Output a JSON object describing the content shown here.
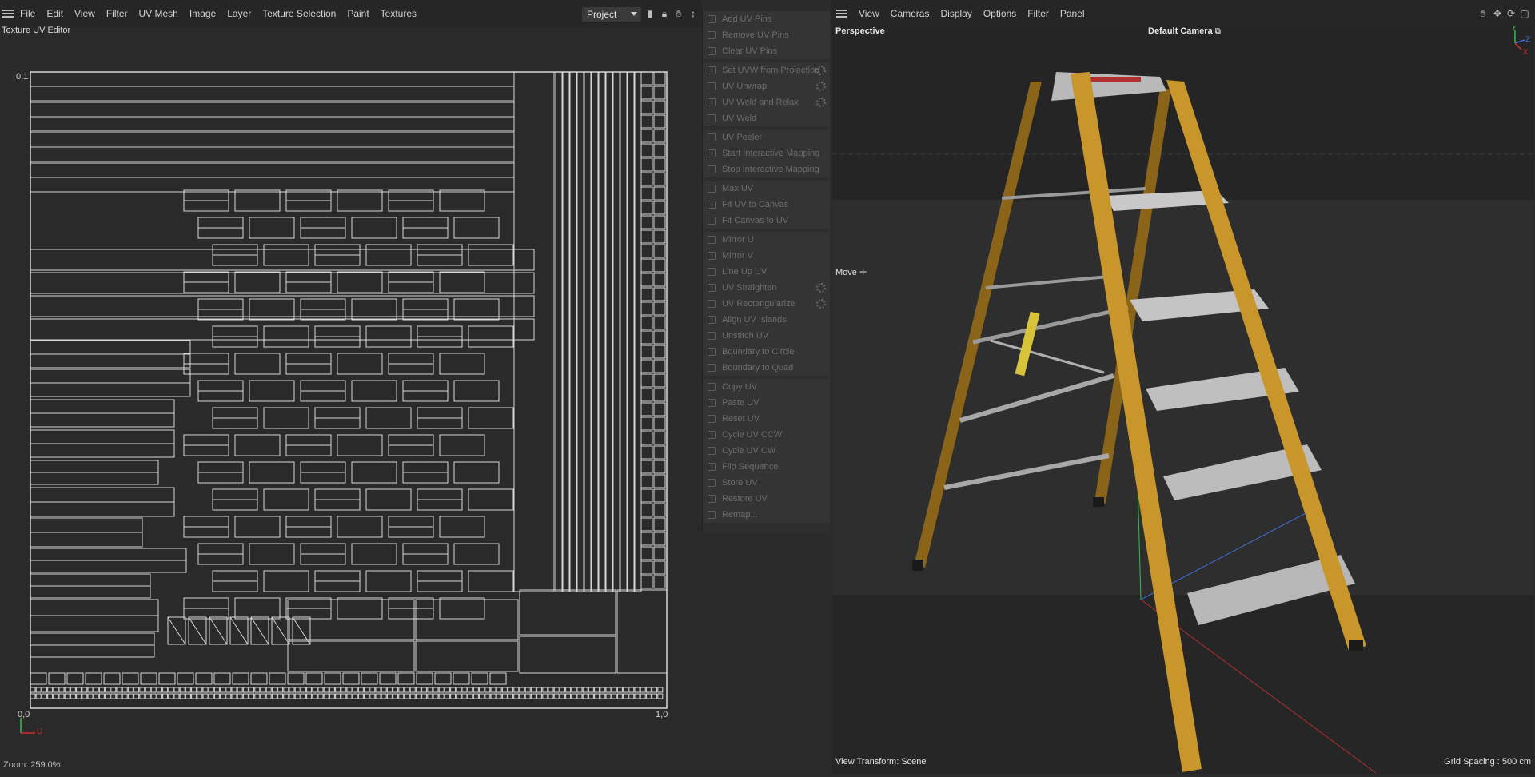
{
  "uv_editor": {
    "menu": [
      "File",
      "Edit",
      "View",
      "Filter",
      "UV Mesh",
      "Image",
      "Layer",
      "Texture Selection",
      "Paint",
      "Textures"
    ],
    "project_select": "Project",
    "panel_title": "Texture UV Editor",
    "axis": {
      "top_left": "0,1",
      "origin": "0,0",
      "bottom_right": "1,0",
      "u_axis": "U"
    },
    "zoom": "Zoom: 259.0%"
  },
  "uv_commands": {
    "groups": [
      [
        "Add UV Pins",
        "Remove UV Pins",
        "Clear UV Pins"
      ],
      [
        "Set UVW from Projection",
        "UV Unwrap",
        "UV Weld and Relax",
        "UV Weld"
      ],
      [
        "UV Peeler",
        "Start Interactive Mapping",
        "Stop Interactive Mapping"
      ],
      [
        "Max UV",
        "Fit UV to Canvas",
        "Fit Canvas to UV"
      ],
      [
        "Mirror U",
        "Mirror V",
        "Line Up UV",
        "UV Straighten",
        "UV Rectangularize",
        "Align UV Islands",
        "Unstitch UV",
        "Boundary to Circle",
        "Boundary to Quad"
      ],
      [
        "Copy UV",
        "Paste UV",
        "Reset UV",
        "Cycle UV CCW",
        "Cycle UV CW",
        "Flip Sequence",
        "Store UV",
        "Restore UV",
        "Remap..."
      ]
    ],
    "with_settings": [
      "Set UVW from Projection",
      "UV Unwrap",
      "UV Weld and Relax",
      "UV Straighten",
      "UV Rectangularize"
    ]
  },
  "viewport": {
    "menu": [
      "View",
      "Cameras",
      "Display",
      "Options",
      "Filter",
      "Panel"
    ],
    "view_name": "Perspective",
    "camera": "Default Camera",
    "tool": "Move",
    "view_transform": "View Transform: Scene",
    "grid_spacing": "Grid Spacing : 500 cm",
    "axis_gizmo": {
      "y": "Y",
      "z": "Z",
      "x": "X"
    }
  },
  "colors": {
    "ladder_rail": "#c8962a",
    "ladder_rail_dark": "#8a6418",
    "step": "#c4c4c4",
    "uv_line": "#d8d8d8",
    "axis_x": "#d03030",
    "axis_y": "#2fbf4f",
    "axis_z": "#3a6fd8"
  }
}
